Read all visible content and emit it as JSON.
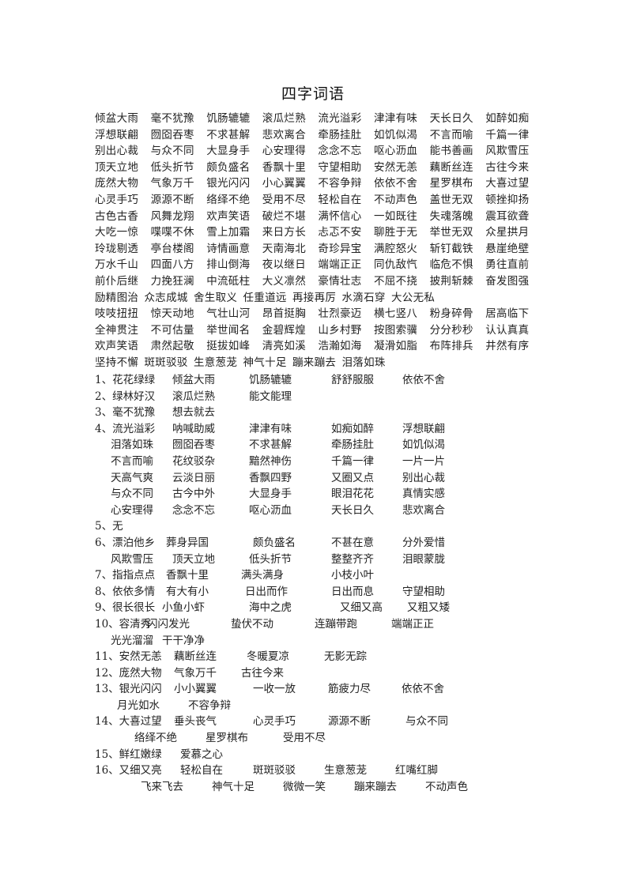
{
  "title": "四字词语",
  "grid": [
    [
      "倾盆大雨",
      "毫不犹豫",
      "饥肠辘辘",
      "滚瓜烂熟",
      "流光溢彩",
      "津津有味",
      "天长日久",
      "如醉如痴"
    ],
    [
      "浮想联翩",
      "囫囵吞枣",
      "不求甚解",
      "悲欢离合",
      "牵肠挂肚",
      "如饥似渴",
      "不言而喻",
      "千篇一律"
    ],
    [
      "别出心裁",
      "与众不同",
      "大显身手",
      "心安理得",
      "念念不忘",
      "呕心沥血",
      "能书善画",
      "风欺雪压"
    ],
    [
      "顶天立地",
      "低头折节",
      "颇负盛名",
      "香飘十里",
      "守望相助",
      "安然无恙",
      "藕断丝连",
      "古往今来"
    ],
    [
      "庞然大物",
      "气象万千",
      "银光闪闪",
      "小心翼翼",
      "不容争辩",
      "依依不舍",
      "星罗棋布",
      "大喜过望"
    ],
    [
      "心灵手巧",
      "源源不断",
      "络绎不绝",
      "受用不尽",
      "轻松自在",
      "不动声色",
      "盖世无双",
      "顿挫抑扬"
    ],
    [
      "古色古香",
      "风舞龙翔",
      "欢声笑语",
      "破烂不堪",
      "满怀信心",
      "一如既往",
      "失魂落魄",
      "震耳欲聋"
    ],
    [
      "大吃一惊",
      "喋喋不休",
      "雪上加霜",
      "来日方长",
      "忐忑不安",
      "聊胜于无",
      "举世无双",
      "众星拱月"
    ],
    [
      "玲珑剔透",
      "亭台楼阁",
      "诗情画意",
      "天南海北",
      "奇珍异宝",
      "满腔怒火",
      "斩钉截铁",
      "悬崖绝壁"
    ],
    [
      "万水千山",
      "四面八方",
      "排山倒海",
      "夜以继日",
      "端端正正",
      "同仇敌忾",
      "临危不惧",
      "勇往直前"
    ],
    [
      "前仆后继",
      "力挽狂澜",
      "中流砥柱",
      "大义凛然",
      "豪情壮志",
      "不屈不挠",
      "披荆斩棘",
      "奋发图强"
    ],
    [
      "励精图治",
      "众志成城",
      "舍生取义",
      "任重道远",
      "再接再厉",
      "水滴石穿",
      "大公无私"
    ],
    [
      "吱吱扭扭",
      "惊天动地",
      "气壮山河",
      "昂首挺胸",
      "壮烈豪迈",
      "横七竖八",
      "粉身碎骨",
      "居高临下"
    ],
    [
      "全神贯注",
      "不可估量",
      "举世闻名",
      "金碧辉煌",
      "山乡村野",
      "按图索骥",
      "分分秒秒",
      "认认真真"
    ],
    [
      "欢声笑语",
      "肃然起敬",
      "挺拔如峰",
      "清亮如溪",
      "浩瀚如海",
      "凝滑如脂",
      "布阵排兵",
      "井然有序"
    ],
    [
      "坚持不懈",
      "斑斑驳驳",
      "生意葱茏",
      "神气十足",
      "蹦来蹦去",
      "泪落如珠"
    ]
  ],
  "list": [
    {
      "items": [
        "1、花花绿绿",
        "倾盆大雨",
        "饥肠辘辘",
        "舒舒服服",
        "依依不舍"
      ]
    },
    {
      "items": [
        "2、绿林好汉",
        "滚瓜烂熟",
        "能文能理"
      ]
    },
    {
      "items": [
        "3、毫不犹豫",
        "想去就去"
      ]
    },
    {
      "items": [
        "4、流光溢彩",
        "呐喊助威",
        "津津有味",
        "如痴如醉",
        "浮想联翩"
      ]
    },
    {
      "items": [
        "泪落如珠",
        "囫囵吞枣",
        "不求甚解",
        "牵肠挂肚",
        "如饥似渴"
      ]
    },
    {
      "items": [
        "不言而喻",
        "花纹驳杂",
        "黯然神伤",
        "千篇一律",
        "一片一片"
      ]
    },
    {
      "items": [
        "天高气爽",
        "云淡日丽",
        "香飘四野",
        "又圈又点",
        "别出心裁"
      ]
    },
    {
      "items": [
        "与众不同",
        "古今中外",
        "大显身手",
        "眼泪花花",
        "真情实感"
      ]
    },
    {
      "items": [
        "心安理得",
        "念念不忘",
        "呕心沥血",
        "天长日久",
        "悲欢离合"
      ]
    },
    {
      "items": [
        "5、无"
      ]
    },
    {
      "items": [
        "6、漂泊他乡",
        "葬身异国",
        "颇负盛名",
        "不甚在意",
        "分外爱惜"
      ]
    },
    {
      "items": [
        "风欺雪压",
        "顶天立地",
        "低头折节",
        "整整齐齐",
        "泪眼蒙胧"
      ]
    },
    {
      "items": [
        "7、指指点点",
        "香飘十里",
        "满头满身",
        "小枝小叶"
      ]
    },
    {
      "items": [
        "8、依依多情",
        "有大有小",
        "日出而作",
        "日出而息",
        "守望相助"
      ]
    },
    {
      "items": [
        "9、很长很长",
        "小鱼小虾",
        "海中之虎",
        "又细又高",
        "又粗又矮"
      ]
    },
    {
      "items": [
        "10、容清秀",
        "闪闪发光",
        "蛰伏不动",
        "连蹦带跑",
        "端端正正"
      ]
    },
    {
      "items": [
        "光光溜溜",
        "干干净净"
      ]
    },
    {
      "items": [
        "11、安然无恙",
        "藕断丝连",
        "冬暖夏凉",
        "无影无踪"
      ]
    },
    {
      "items": [
        "12、庞然大物",
        "气象万千",
        "古往今来"
      ]
    },
    {
      "items": [
        "13、银光闪闪",
        "小小翼翼",
        "一收一放",
        "筋疲力尽",
        "依依不舍"
      ]
    },
    {
      "items": [
        "月光如水",
        "不容争辩"
      ]
    },
    {
      "items": [
        "14、大喜过望",
        "垂头丧气",
        "心灵手巧",
        "源源不断",
        "与众不同"
      ]
    },
    {
      "items": [
        "络绎不绝",
        "星罗棋布",
        "受用不尽"
      ]
    },
    {
      "items": [
        "15、鲜红嫩绿",
        "爱慕之心"
      ]
    },
    {
      "items": [
        "16、又细又亮",
        "轻松自在",
        "斑斑驳驳",
        "生意葱茏",
        "红嘴红脚"
      ]
    },
    {
      "items": [
        "飞来飞去",
        "神气十足",
        "微微一笑",
        "蹦来蹦去",
        "不动声色"
      ]
    }
  ]
}
